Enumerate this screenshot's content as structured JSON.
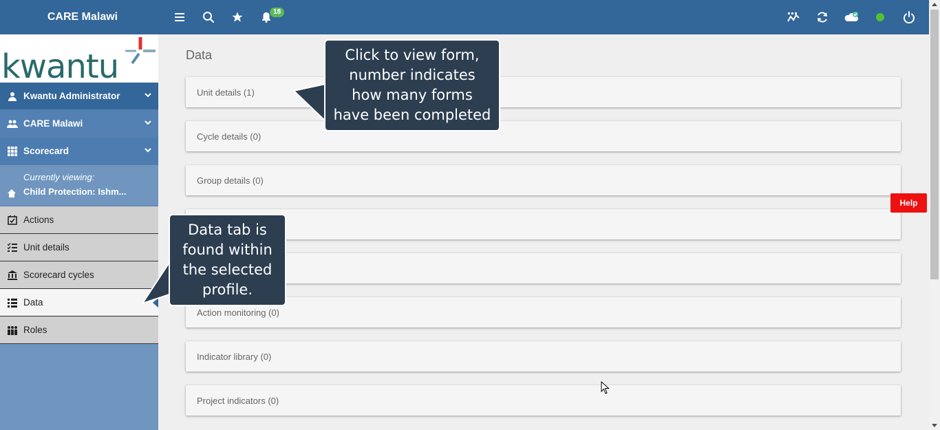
{
  "app": {
    "title": "CARE Malawi",
    "notification_count": "18"
  },
  "sidebar": {
    "logo_text": "kwantu",
    "user": "Kwantu Administrator",
    "org": "CARE Malawi",
    "module": "Scorecard",
    "viewing_label": "Currently viewing:",
    "viewing_value": "Child Protection: Ishm...",
    "nav": [
      "Actions",
      "Unit details",
      "Scorecard cycles",
      "Data",
      "Roles"
    ],
    "active": "Data"
  },
  "main": {
    "title": "Data",
    "cards": [
      "Unit details (1)",
      "Cycle details (0)",
      "Group details (0)",
      "",
      "",
      "Action monitoring (0)",
      "Indicator library (0)",
      "Project indicators (0)"
    ]
  },
  "help_label": "Help",
  "callouts": {
    "form": [
      "Click to view form,",
      "number indicates",
      "how many forms",
      "have been completed"
    ],
    "tab": [
      "Data tab is",
      "found within",
      "the selected",
      "profile."
    ]
  },
  "colors": {
    "topbar": "#336699",
    "sidebar": "#7096bf",
    "callout": "#2c3e50",
    "help": "#ee1111",
    "badge": "#5cb85c",
    "online": "#53c232"
  }
}
